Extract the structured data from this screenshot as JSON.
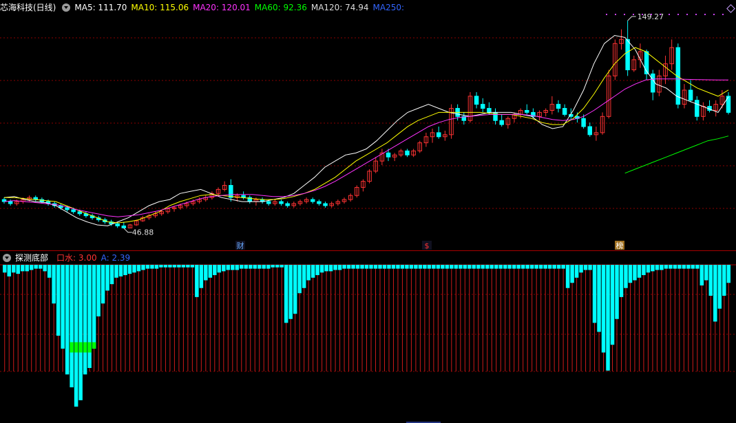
{
  "main_panel": {
    "stock_name": "芯海科技(日线)",
    "indicators": [
      {
        "label": "MA5: 111.70",
        "color": "#ffffff"
      },
      {
        "label": "MA10: 115.06",
        "color": "#ffff00"
      },
      {
        "label": "MA20: 120.01",
        "color": "#ff33ff"
      },
      {
        "label": "MA60: 92.36",
        "color": "#00ff00"
      },
      {
        "label": "MA120: 74.94",
        "color": "#dddddd"
      },
      {
        "label": "MA250:",
        "color": "#3366ff"
      }
    ],
    "high_label": "149.27",
    "low_label": "46.88",
    "markers": [
      {
        "text": "财",
        "color": "#66aaff"
      },
      {
        "text": "$",
        "color": "#ff3333"
      },
      {
        "text": "榜",
        "color": "#ffffff"
      }
    ]
  },
  "sub_panel": {
    "title": "探测底部",
    "indicators": [
      {
        "label": "口水: 3.00",
        "color": "#ff3333"
      },
      {
        "label": "A: 2.39",
        "color": "#3366ff"
      }
    ]
  },
  "colors": {
    "up": "#ff3333",
    "down": "#00ffff",
    "green_bar": "#00ff00",
    "grid": "#8b0000",
    "background": "#000000"
  },
  "chart_data": {
    "type": "candlestick",
    "candles": [
      [
        61,
        62,
        59,
        60
      ],
      [
        60,
        61,
        58,
        59
      ],
      [
        59,
        61,
        58,
        60
      ],
      [
        60,
        62,
        59,
        61
      ],
      [
        61,
        63,
        60,
        62
      ],
      [
        62,
        63,
        60,
        61
      ],
      [
        61,
        62,
        59,
        60
      ],
      [
        60,
        61,
        58,
        59
      ],
      [
        59,
        60,
        57,
        58
      ],
      [
        58,
        59,
        56,
        57
      ],
      [
        57,
        58,
        55,
        56
      ],
      [
        56,
        57,
        54,
        55
      ],
      [
        55,
        56,
        53,
        54
      ],
      [
        54,
        55,
        52,
        53
      ],
      [
        53,
        54,
        51,
        52
      ],
      [
        52,
        53,
        50,
        51
      ],
      [
        51,
        52,
        49,
        50
      ],
      [
        50,
        51,
        48,
        49
      ],
      [
        49,
        50,
        47,
        48
      ],
      [
        48,
        50,
        46.88,
        47
      ],
      [
        47,
        49,
        46.9,
        48.5
      ],
      [
        48.5,
        51,
        48,
        50.5
      ],
      [
        50.5,
        53,
        50,
        52
      ],
      [
        52,
        54,
        51,
        53
      ],
      [
        53,
        55,
        52,
        54
      ],
      [
        54,
        56,
        53,
        55
      ],
      [
        55,
        57,
        54,
        56.5
      ],
      [
        56.5,
        58,
        55,
        57
      ],
      [
        57,
        59,
        56,
        58
      ],
      [
        58,
        60,
        57,
        59
      ],
      [
        59,
        61,
        58,
        60
      ],
      [
        60,
        62,
        59,
        61
      ],
      [
        61,
        63,
        60,
        62
      ],
      [
        62,
        65,
        61,
        64
      ],
      [
        64,
        67,
        63,
        66
      ],
      [
        66,
        70,
        65,
        68
      ],
      [
        68,
        71,
        60,
        62
      ],
      [
        62,
        64,
        60,
        63
      ],
      [
        63,
        65,
        61,
        62
      ],
      [
        62,
        63,
        59,
        60
      ],
      [
        60,
        62,
        58,
        61
      ],
      [
        61,
        62,
        59,
        60
      ],
      [
        60,
        61,
        58,
        59
      ],
      [
        59,
        61,
        58,
        60
      ],
      [
        60,
        61,
        58,
        59
      ],
      [
        59,
        60,
        57,
        58
      ],
      [
        58,
        60,
        57,
        59
      ],
      [
        59,
        61,
        58,
        60
      ],
      [
        60,
        62,
        59,
        61
      ],
      [
        61,
        62,
        59,
        60
      ],
      [
        60,
        61,
        58,
        59
      ],
      [
        59,
        60,
        57,
        58
      ],
      [
        58,
        60,
        57,
        59
      ],
      [
        59,
        61,
        58,
        60
      ],
      [
        60,
        62,
        59,
        61
      ],
      [
        61,
        64,
        60,
        63
      ],
      [
        63,
        68,
        62,
        67
      ],
      [
        67,
        71,
        65,
        70
      ],
      [
        70,
        76,
        69,
        75
      ],
      [
        75,
        82,
        74,
        80
      ],
      [
        80,
        86,
        78,
        84
      ],
      [
        84,
        86,
        80,
        82
      ],
      [
        82,
        84,
        80,
        83
      ],
      [
        83,
        86,
        82,
        85
      ],
      [
        85,
        86,
        82,
        83
      ],
      [
        83,
        86,
        82,
        85
      ],
      [
        85,
        90,
        84,
        89
      ],
      [
        89,
        94,
        87,
        92
      ],
      [
        92,
        96,
        89,
        94
      ],
      [
        94,
        97,
        91,
        92
      ],
      [
        92,
        95,
        90,
        93
      ],
      [
        93,
        108,
        91,
        106
      ],
      [
        106,
        108,
        100,
        102
      ],
      [
        102,
        104,
        98,
        100
      ],
      [
        100,
        114,
        99,
        112
      ],
      [
        112,
        114,
        106,
        108
      ],
      [
        108,
        111,
        104,
        106
      ],
      [
        106,
        109,
        103,
        104
      ],
      [
        104,
        106,
        98,
        100
      ],
      [
        100,
        103,
        97,
        98
      ],
      [
        98,
        102,
        96,
        101
      ],
      [
        101,
        104,
        99,
        103
      ],
      [
        103,
        106,
        101,
        105
      ],
      [
        105,
        108,
        103,
        104
      ],
      [
        104,
        106,
        101,
        102
      ],
      [
        102,
        105,
        100,
        104
      ],
      [
        104,
        106,
        102,
        105
      ],
      [
        105,
        112,
        103,
        108
      ],
      [
        108,
        110,
        104,
        106
      ],
      [
        106,
        108,
        102,
        103
      ],
      [
        103,
        106,
        100,
        102
      ],
      [
        102,
        104,
        99,
        101
      ],
      [
        101,
        103,
        96,
        97
      ],
      [
        97,
        99,
        92,
        93
      ],
      [
        93,
        97,
        90,
        94
      ],
      [
        94,
        104,
        93,
        102
      ],
      [
        102,
        125,
        101,
        122
      ],
      [
        122,
        140,
        120,
        138
      ],
      [
        138,
        145,
        135,
        140
      ],
      [
        140,
        149.27,
        122,
        125
      ],
      [
        125,
        132,
        124,
        130
      ],
      [
        130,
        138,
        126,
        134
      ],
      [
        134,
        135,
        120,
        123
      ],
      [
        123,
        125,
        110,
        114
      ],
      [
        114,
        125,
        112,
        122
      ],
      [
        122,
        132,
        118,
        128
      ],
      [
        128,
        140,
        125,
        136
      ],
      [
        136,
        138,
        106,
        108
      ],
      [
        108,
        118,
        106,
        115
      ],
      [
        115,
        120,
        109,
        110
      ],
      [
        110,
        112,
        100,
        102
      ],
      [
        102,
        109,
        100,
        107
      ],
      [
        107,
        110,
        104,
        105
      ],
      [
        105,
        110,
        102,
        108
      ],
      [
        108,
        115,
        106,
        112
      ],
      [
        112,
        114,
        103,
        104
      ]
    ],
    "ma_series": [
      {
        "name": "MA5",
        "color": "#ffffff",
        "values": [
          62,
          62.5,
          61,
          60,
          59.5,
          58,
          55,
          52,
          50,
          48.5,
          48,
          50,
          52,
          55,
          58,
          60,
          61,
          64,
          65,
          66,
          64,
          62,
          61,
          60,
          60,
          60,
          61,
          62,
          64,
          68,
          72,
          77,
          80,
          83,
          84,
          86,
          90,
          95,
          100,
          104,
          106,
          108,
          106,
          104,
          103,
          102,
          103,
          104,
          104,
          104,
          103,
          102,
          98,
          96,
          97,
          105,
          115,
          128,
          138,
          142,
          141,
          135,
          125,
          118,
          116,
          112,
          110,
          108,
          106,
          104,
          111.7
        ]
      },
      {
        "name": "MA10",
        "color": "#ffff00",
        "values": [
          62,
          62,
          61.5,
          61,
          60.5,
          60,
          58,
          56,
          54,
          52,
          50,
          49.5,
          50,
          51,
          53,
          55,
          58,
          60,
          61.5,
          63,
          63.5,
          63,
          62.5,
          62,
          61.5,
          61,
          61,
          61.5,
          62.5,
          64,
          66,
          69,
          72,
          76,
          80,
          83,
          86,
          89,
          93,
          97,
          100,
          102,
          104,
          104,
          104,
          104,
          104,
          103.5,
          103,
          103,
          102,
          101,
          99,
          98,
          98,
          101,
          106,
          113,
          121,
          128,
          133,
          136,
          134,
          130,
          126,
          122,
          119,
          116,
          114,
          112,
          115.06
        ]
      },
      {
        "name": "MA20",
        "color": "#ff33ff",
        "values": [
          60,
          60.5,
          60,
          59.5,
          59,
          58.5,
          57.5,
          56,
          55,
          54,
          53,
          52.5,
          53,
          53.5,
          54.5,
          55.5,
          57,
          58.5,
          60,
          61.5,
          62.5,
          63,
          63.5,
          63.5,
          63.5,
          63,
          62.5,
          62.5,
          63,
          64,
          65.5,
          67.5,
          70,
          73,
          76,
          79,
          82,
          85,
          88,
          91,
          94,
          97,
          99,
          100.5,
          101.5,
          102,
          102.5,
          103,
          103,
          103,
          103,
          102.5,
          101.5,
          100.5,
          100,
          100.5,
          102,
          105,
          108.5,
          112,
          115.5,
          118,
          120,
          120.5,
          120.5,
          120.5,
          120.3,
          120.2,
          120.1,
          120,
          120.01
        ]
      },
      {
        "name": "MA60",
        "color": "#00ff00",
        "values": [
          null,
          null,
          null,
          null,
          null,
          null,
          null,
          null,
          null,
          null,
          null,
          null,
          null,
          null,
          null,
          null,
          null,
          null,
          null,
          null,
          null,
          null,
          null,
          null,
          null,
          null,
          null,
          null,
          null,
          null,
          null,
          null,
          null,
          null,
          null,
          null,
          null,
          null,
          null,
          null,
          null,
          null,
          null,
          null,
          null,
          null,
          null,
          null,
          null,
          null,
          null,
          null,
          null,
          null,
          null,
          null,
          null,
          null,
          null,
          null,
          74,
          76,
          78,
          80,
          82,
          84,
          86,
          88,
          90,
          91,
          92.36
        ]
      },
      {
        "name": "MA120",
        "color": "#dddddd",
        "values": [
          null,
          null,
          null,
          null,
          null,
          null,
          null,
          null,
          null,
          null,
          null,
          null,
          null,
          null,
          null,
          null,
          null,
          null,
          null,
          null,
          null,
          null,
          null,
          null,
          null,
          null,
          null,
          null,
          null,
          null,
          null,
          null,
          null,
          null,
          null,
          null,
          null,
          null,
          null,
          null,
          null,
          null,
          null,
          null,
          null,
          null,
          null,
          null,
          null,
          null,
          null,
          null,
          null,
          null,
          null,
          null,
          null,
          null,
          null,
          null,
          null,
          null,
          null,
          null,
          null,
          null,
          null,
          null,
          null,
          null,
          74.94
        ]
      }
    ],
    "sub_values": [
      6,
      9,
      6,
      7,
      5,
      5,
      4,
      3,
      3,
      5,
      10,
      30,
      55,
      65,
      85,
      95,
      110,
      105,
      85,
      80,
      65,
      40,
      30,
      20,
      15,
      10,
      9,
      8,
      7,
      6,
      5,
      4,
      3,
      3,
      3,
      2,
      2,
      2,
      2,
      2,
      2,
      2,
      2,
      25,
      18,
      12,
      10,
      8,
      6,
      5,
      4,
      4,
      4,
      3,
      3,
      3,
      3,
      3,
      3,
      3,
      2,
      2,
      2,
      45,
      42,
      38,
      22,
      18,
      12,
      10,
      8,
      6,
      5,
      5,
      4,
      4,
      3,
      3,
      3,
      3,
      3,
      3,
      3,
      3,
      3,
      3,
      3,
      3,
      3,
      3,
      3,
      3,
      3,
      3,
      3,
      3,
      3,
      3,
      3,
      3,
      3,
      3,
      3,
      3,
      3,
      3,
      3,
      3,
      3,
      3,
      3,
      3,
      3,
      3,
      3,
      3,
      3,
      3,
      3,
      3,
      3,
      3,
      3,
      3,
      3,
      3,
      18,
      14,
      10,
      6,
      4,
      4,
      45,
      52,
      68,
      82,
      62,
      42,
      25,
      18,
      14,
      12,
      10,
      8,
      6,
      5,
      4,
      4,
      3,
      3,
      3,
      3,
      3,
      3,
      3,
      3,
      16,
      12,
      24,
      44,
      34,
      24,
      14
    ],
    "sub_ylim": [
      0,
      120
    ],
    "green_range": [
      15,
      20
    ]
  }
}
